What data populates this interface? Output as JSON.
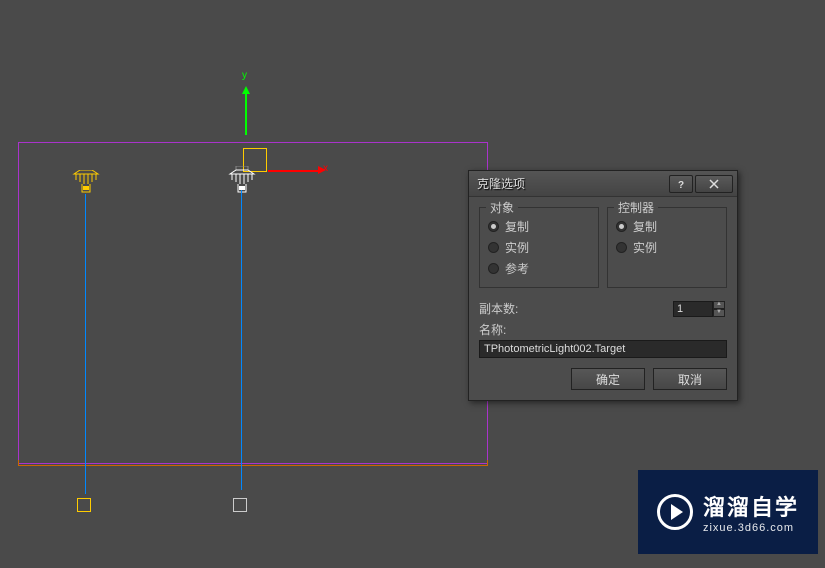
{
  "axis": {
    "x": "x",
    "y": "y"
  },
  "dialog": {
    "title": "克隆选项",
    "object_group_label": "对象",
    "controller_group_label": "控制器",
    "object_options": {
      "copy": "复制",
      "instance": "实例",
      "reference": "参考"
    },
    "controller_options": {
      "copy": "复制",
      "instance": "实例"
    },
    "object_selected": "copy",
    "controller_selected": "copy",
    "copies_label": "副本数:",
    "copies_value": "1",
    "name_label": "名称:",
    "name_value": "TPhotometricLight002.Target",
    "ok": "确定",
    "cancel": "取消"
  },
  "watermark": {
    "main": "溜溜自学",
    "sub": "zixue.3d66.com"
  }
}
